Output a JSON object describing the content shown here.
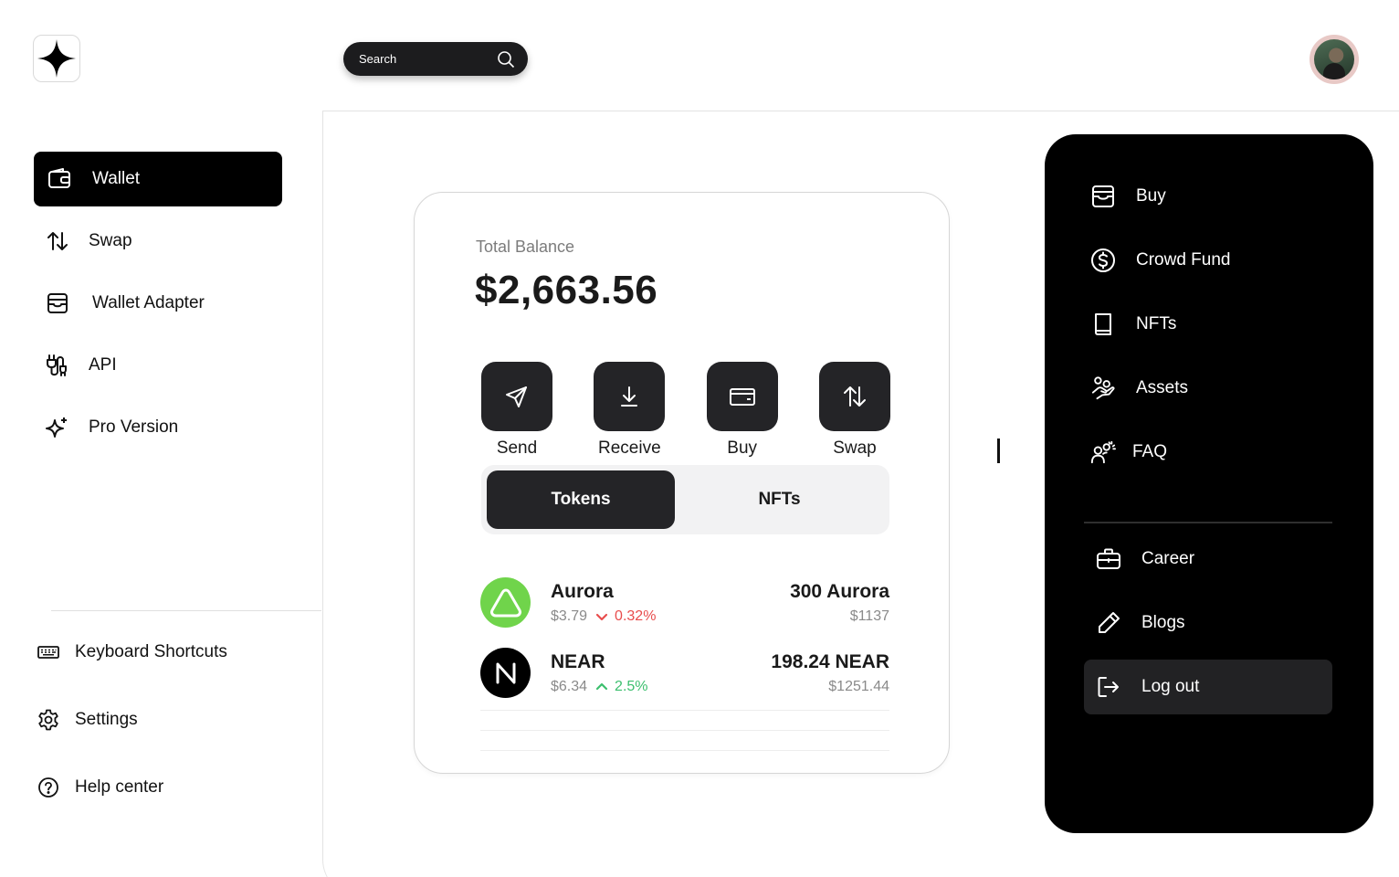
{
  "header": {
    "search_placeholder": "Search"
  },
  "sidebar": {
    "items": [
      {
        "label": "Wallet",
        "icon": "wallet-icon",
        "active": true
      },
      {
        "label": "Swap",
        "icon": "swap-arrows-icon",
        "active": false
      },
      {
        "label": "Wallet Adapter",
        "icon": "wallet-adapter-icon",
        "active": false
      },
      {
        "label": "API",
        "icon": "api-plug-icon",
        "active": false
      },
      {
        "label": "Pro Version",
        "icon": "sparkles-icon",
        "active": false
      }
    ],
    "bottom": [
      {
        "label": "Keyboard Shortcuts",
        "icon": "keyboard-icon"
      },
      {
        "label": "Settings",
        "icon": "gear-icon"
      },
      {
        "label": "Help center",
        "icon": "help-circle-icon"
      }
    ]
  },
  "wallet": {
    "balance_label": "Total Balance",
    "balance_value": "$2,663.56",
    "actions": [
      {
        "label": "Send",
        "icon": "send-icon"
      },
      {
        "label": "Receive",
        "icon": "download-icon"
      },
      {
        "label": "Buy",
        "icon": "card-icon"
      },
      {
        "label": "Swap",
        "icon": "swap-arrows-icon"
      }
    ],
    "tabs": [
      {
        "label": "Tokens",
        "active": true
      },
      {
        "label": "NFTs",
        "active": false
      }
    ],
    "tokens": [
      {
        "name": "Aurora",
        "price": "$3.79",
        "change": "0.32%",
        "direction": "down",
        "amount": "300 Aurora",
        "value": "$1137",
        "logo_color": "#70d44b"
      },
      {
        "name": "NEAR",
        "price": "$6.34",
        "change": "2.5%",
        "direction": "up",
        "amount": "198.24 NEAR",
        "value": "$1251.44",
        "logo_color": "#000000"
      }
    ]
  },
  "menu": {
    "items": [
      {
        "label": "Buy",
        "icon": "inbox-card-icon"
      },
      {
        "label": "Crowd Fund",
        "icon": "dollar-circle-icon"
      },
      {
        "label": "NFTs",
        "icon": "book-icon"
      },
      {
        "label": "Assets",
        "icon": "hand-coins-icon"
      },
      {
        "label": "FAQ",
        "icon": "users-icon"
      }
    ],
    "secondary": [
      {
        "label": "Career",
        "icon": "briefcase-icon"
      },
      {
        "label": "Blogs",
        "icon": "pencil-icon"
      },
      {
        "label": "Log out",
        "icon": "logout-icon"
      }
    ]
  },
  "colors": {
    "accent_dark": "#242427",
    "positive": "#3cbf6e",
    "negative": "#e84d4d",
    "aurora": "#70d44b"
  }
}
